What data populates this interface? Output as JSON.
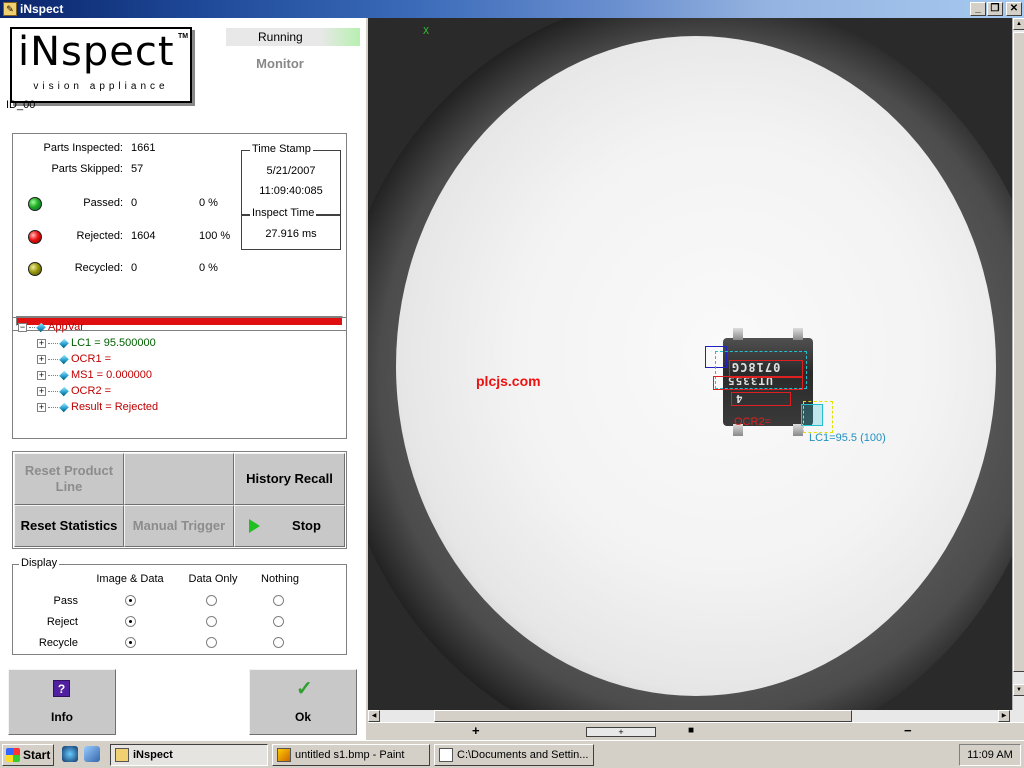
{
  "window": {
    "title": "iNspect",
    "controls": {
      "minimize": "_",
      "restore": "❐",
      "close": "✕"
    }
  },
  "logo": {
    "main": "iNspect",
    "trademark": "TM",
    "sub": "vision appliance"
  },
  "status": {
    "state": "Running",
    "mode": "Monitor"
  },
  "station_id": "ID_00",
  "stats": {
    "parts_inspected_label": "Parts Inspected:",
    "parts_inspected": "1661",
    "parts_skipped_label": "Parts Skipped:",
    "parts_skipped": "57",
    "passed_label": "Passed:",
    "passed_count": "0",
    "passed_pct": "0 %",
    "rejected_label": "Rejected:",
    "rejected_count": "1604",
    "rejected_pct": "100 %",
    "recycled_label": "Recycled:",
    "recycled_count": "0",
    "recycled_pct": "0 %",
    "colors": {
      "passed": "#22aa22",
      "rejected": "#ee1111",
      "recycled": "#999911"
    }
  },
  "timestamp": {
    "title": "Time Stamp",
    "date": "5/21/2007",
    "time": "11:09:40:085"
  },
  "inspect_time": {
    "title": "Inspect Time",
    "value": "27.916 ms"
  },
  "result_bar": {
    "fraction": 1.0,
    "color": "#e01010"
  },
  "tree": {
    "root": "AppVar",
    "root_toggle": "−",
    "items": [
      {
        "toggle": "+",
        "text": "LC1 = 95.500000",
        "color": "green"
      },
      {
        "toggle": "+",
        "text": "OCR1 =",
        "color": "red"
      },
      {
        "toggle": "+",
        "text": "MS1 = 0.000000",
        "color": "red"
      },
      {
        "toggle": "+",
        "text": "OCR2 =",
        "color": "red"
      },
      {
        "toggle": "+",
        "text": "Result = Rejected",
        "color": "red"
      }
    ]
  },
  "buttons": {
    "reset_product_line": "Reset Product Line",
    "blank": "",
    "history_recall": "History Recall",
    "reset_statistics": "Reset Statistics",
    "manual_trigger": "Manual Trigger",
    "stop": "Stop"
  },
  "display": {
    "title": "Display",
    "columns": [
      "Image & Data",
      "Data Only",
      "Nothing"
    ],
    "rows": [
      {
        "label": "Pass",
        "selected": 0
      },
      {
        "label": "Reject",
        "selected": 0
      },
      {
        "label": "Recycle",
        "selected": 0
      }
    ]
  },
  "footer": {
    "info": "Info",
    "info_icon": "?",
    "ok": "Ok",
    "ok_icon": "✓"
  },
  "viewer": {
    "x_marker": "X",
    "watermark": "plcjs.com",
    "chip_marking": "0718CG",
    "chip_marking_2": "UT3355",
    "chip_marking_3": "4",
    "ocr2_label": "OCR2=",
    "lc1_label": "LC1=95.5 (100)",
    "zoom": {
      "plus": "+",
      "slider": "+",
      "stop": "■",
      "minus": "−"
    }
  },
  "taskbar": {
    "start": "Start",
    "items": [
      {
        "label": "iNspect",
        "active": true
      },
      {
        "label": "untitled s1.bmp - Paint",
        "active": false
      },
      {
        "label": "C:\\Documents and Settin...",
        "active": false
      }
    ],
    "clock": "11:09 AM"
  }
}
